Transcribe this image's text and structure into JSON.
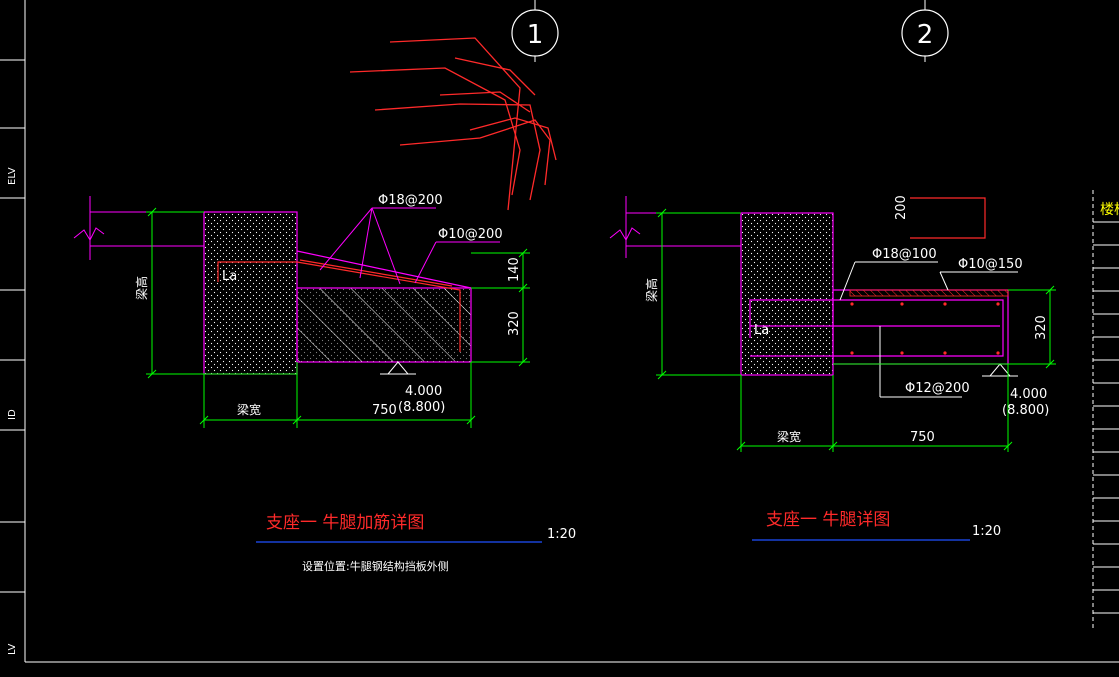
{
  "colors": {
    "background": "#000000",
    "frame": "#ffffff",
    "outline": "#ff00ff",
    "rebar": "#ff2a2a",
    "dimension": "#00ff00",
    "text": "#ffffff",
    "title": "#ff2a2a",
    "title_underline": "#1f4fff",
    "sidebar_text": "#ffff00"
  },
  "left_strip": {
    "labels": [
      "ELV",
      "ID",
      "LV"
    ]
  },
  "detail1": {
    "circle_label": "1",
    "rebar_label_1": "Φ18@200",
    "rebar_label_2": "Φ10@200",
    "anchor_label": "La",
    "beam_height_label": "梁高",
    "beam_width_label": "梁宽",
    "dim_140": "140",
    "dim_320": "320",
    "dim_750": "750",
    "elevation": "4.000",
    "elevation_alt": "(8.800)",
    "title": "支座一 牛腿加筋详图",
    "scale": "1:20",
    "note": "设置位置:牛腿钢结构挡板外侧"
  },
  "detail2": {
    "circle_label": "2",
    "dim_200": "200",
    "rebar_label_1": "Φ18@100",
    "rebar_label_2": "Φ10@150",
    "rebar_label_3": "Φ12@200",
    "anchor_label": "La",
    "beam_height_label": "梁高",
    "beam_width_label": "梁宽",
    "dim_320": "320",
    "dim_750": "750",
    "elevation": "4.000",
    "elevation_alt": "(8.800)",
    "title": "支座一 牛腿详图",
    "scale": "1:20"
  },
  "right_sidebar": {
    "label": "楼梯"
  }
}
